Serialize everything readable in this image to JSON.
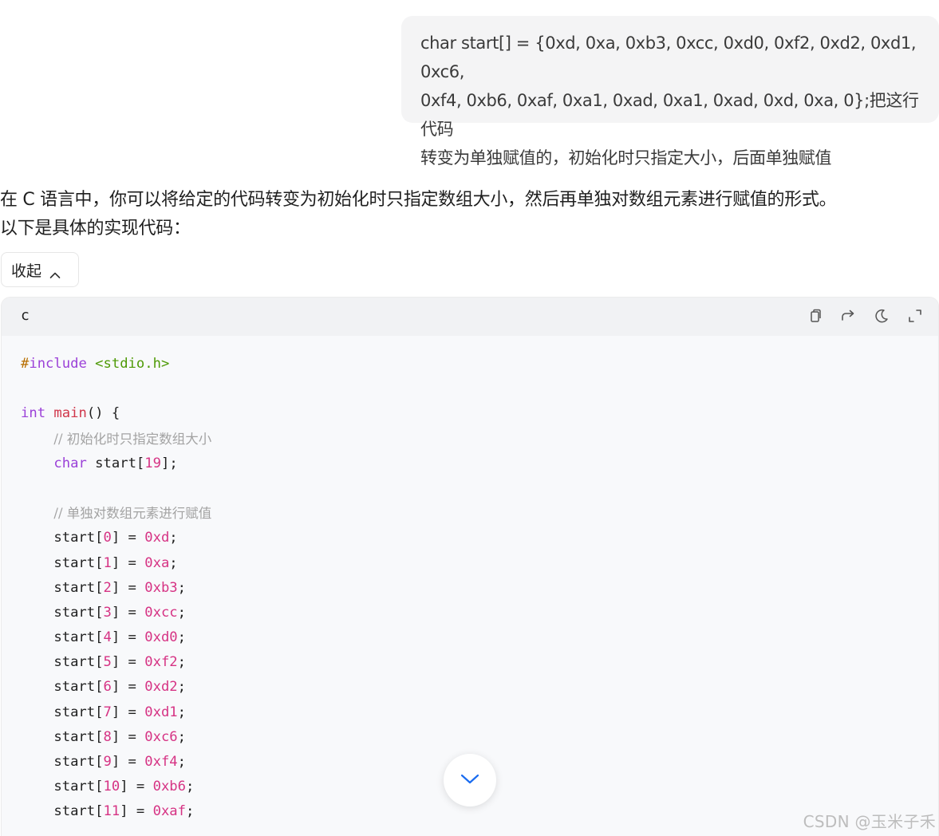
{
  "user_message": {
    "lines": [
      "char start[] = {0xd, 0xa, 0xb3, 0xcc, 0xd0, 0xf2, 0xd2, 0xd1, 0xc6,",
      "0xf4, 0xb6, 0xaf, 0xa1, 0xad, 0xa1, 0xad, 0xd, 0xa, 0};把这行代码",
      "转变为单独赋值的，初始化时只指定大小，后面单独赋值"
    ]
  },
  "answer": {
    "intro_lines": [
      "在 C 语言中，你可以将给定的代码转变为初始化时只指定数组大小，然后再单独对数组元素进行赋值的形式。",
      "以下是具体的实现代码："
    ],
    "collapse_label": "收起"
  },
  "code_block": {
    "language": "c",
    "include_directive": "#include",
    "include_header": "<stdio.h>",
    "main_type": "int",
    "main_name": "main",
    "main_rest": "() {",
    "comment1": "// 初始化时只指定数组大小",
    "decl_type": "char",
    "decl_name": "start[",
    "decl_size": "19",
    "decl_end": "];",
    "comment2": "// 单独对数组元素进行赋值",
    "assignments": [
      {
        "index": "0",
        "value": "0xd"
      },
      {
        "index": "1",
        "value": "0xa"
      },
      {
        "index": "2",
        "value": "0xb3"
      },
      {
        "index": "3",
        "value": "0xcc"
      },
      {
        "index": "4",
        "value": "0xd0"
      },
      {
        "index": "5",
        "value": "0xf2"
      },
      {
        "index": "6",
        "value": "0xd2"
      },
      {
        "index": "7",
        "value": "0xd1"
      },
      {
        "index": "8",
        "value": "0xc6"
      },
      {
        "index": "9",
        "value": "0xf4"
      },
      {
        "index": "10",
        "value": "0xb6"
      },
      {
        "index": "11",
        "value": "0xaf"
      }
    ]
  },
  "icons": {
    "copy": "copy-icon",
    "share": "share-icon",
    "theme": "moon-icon",
    "expand": "expand-icon",
    "scroll": "chevron-down-icon"
  },
  "colors": {
    "accent": "#1a6cf0"
  },
  "watermark": "CSDN @玉米子禾"
}
